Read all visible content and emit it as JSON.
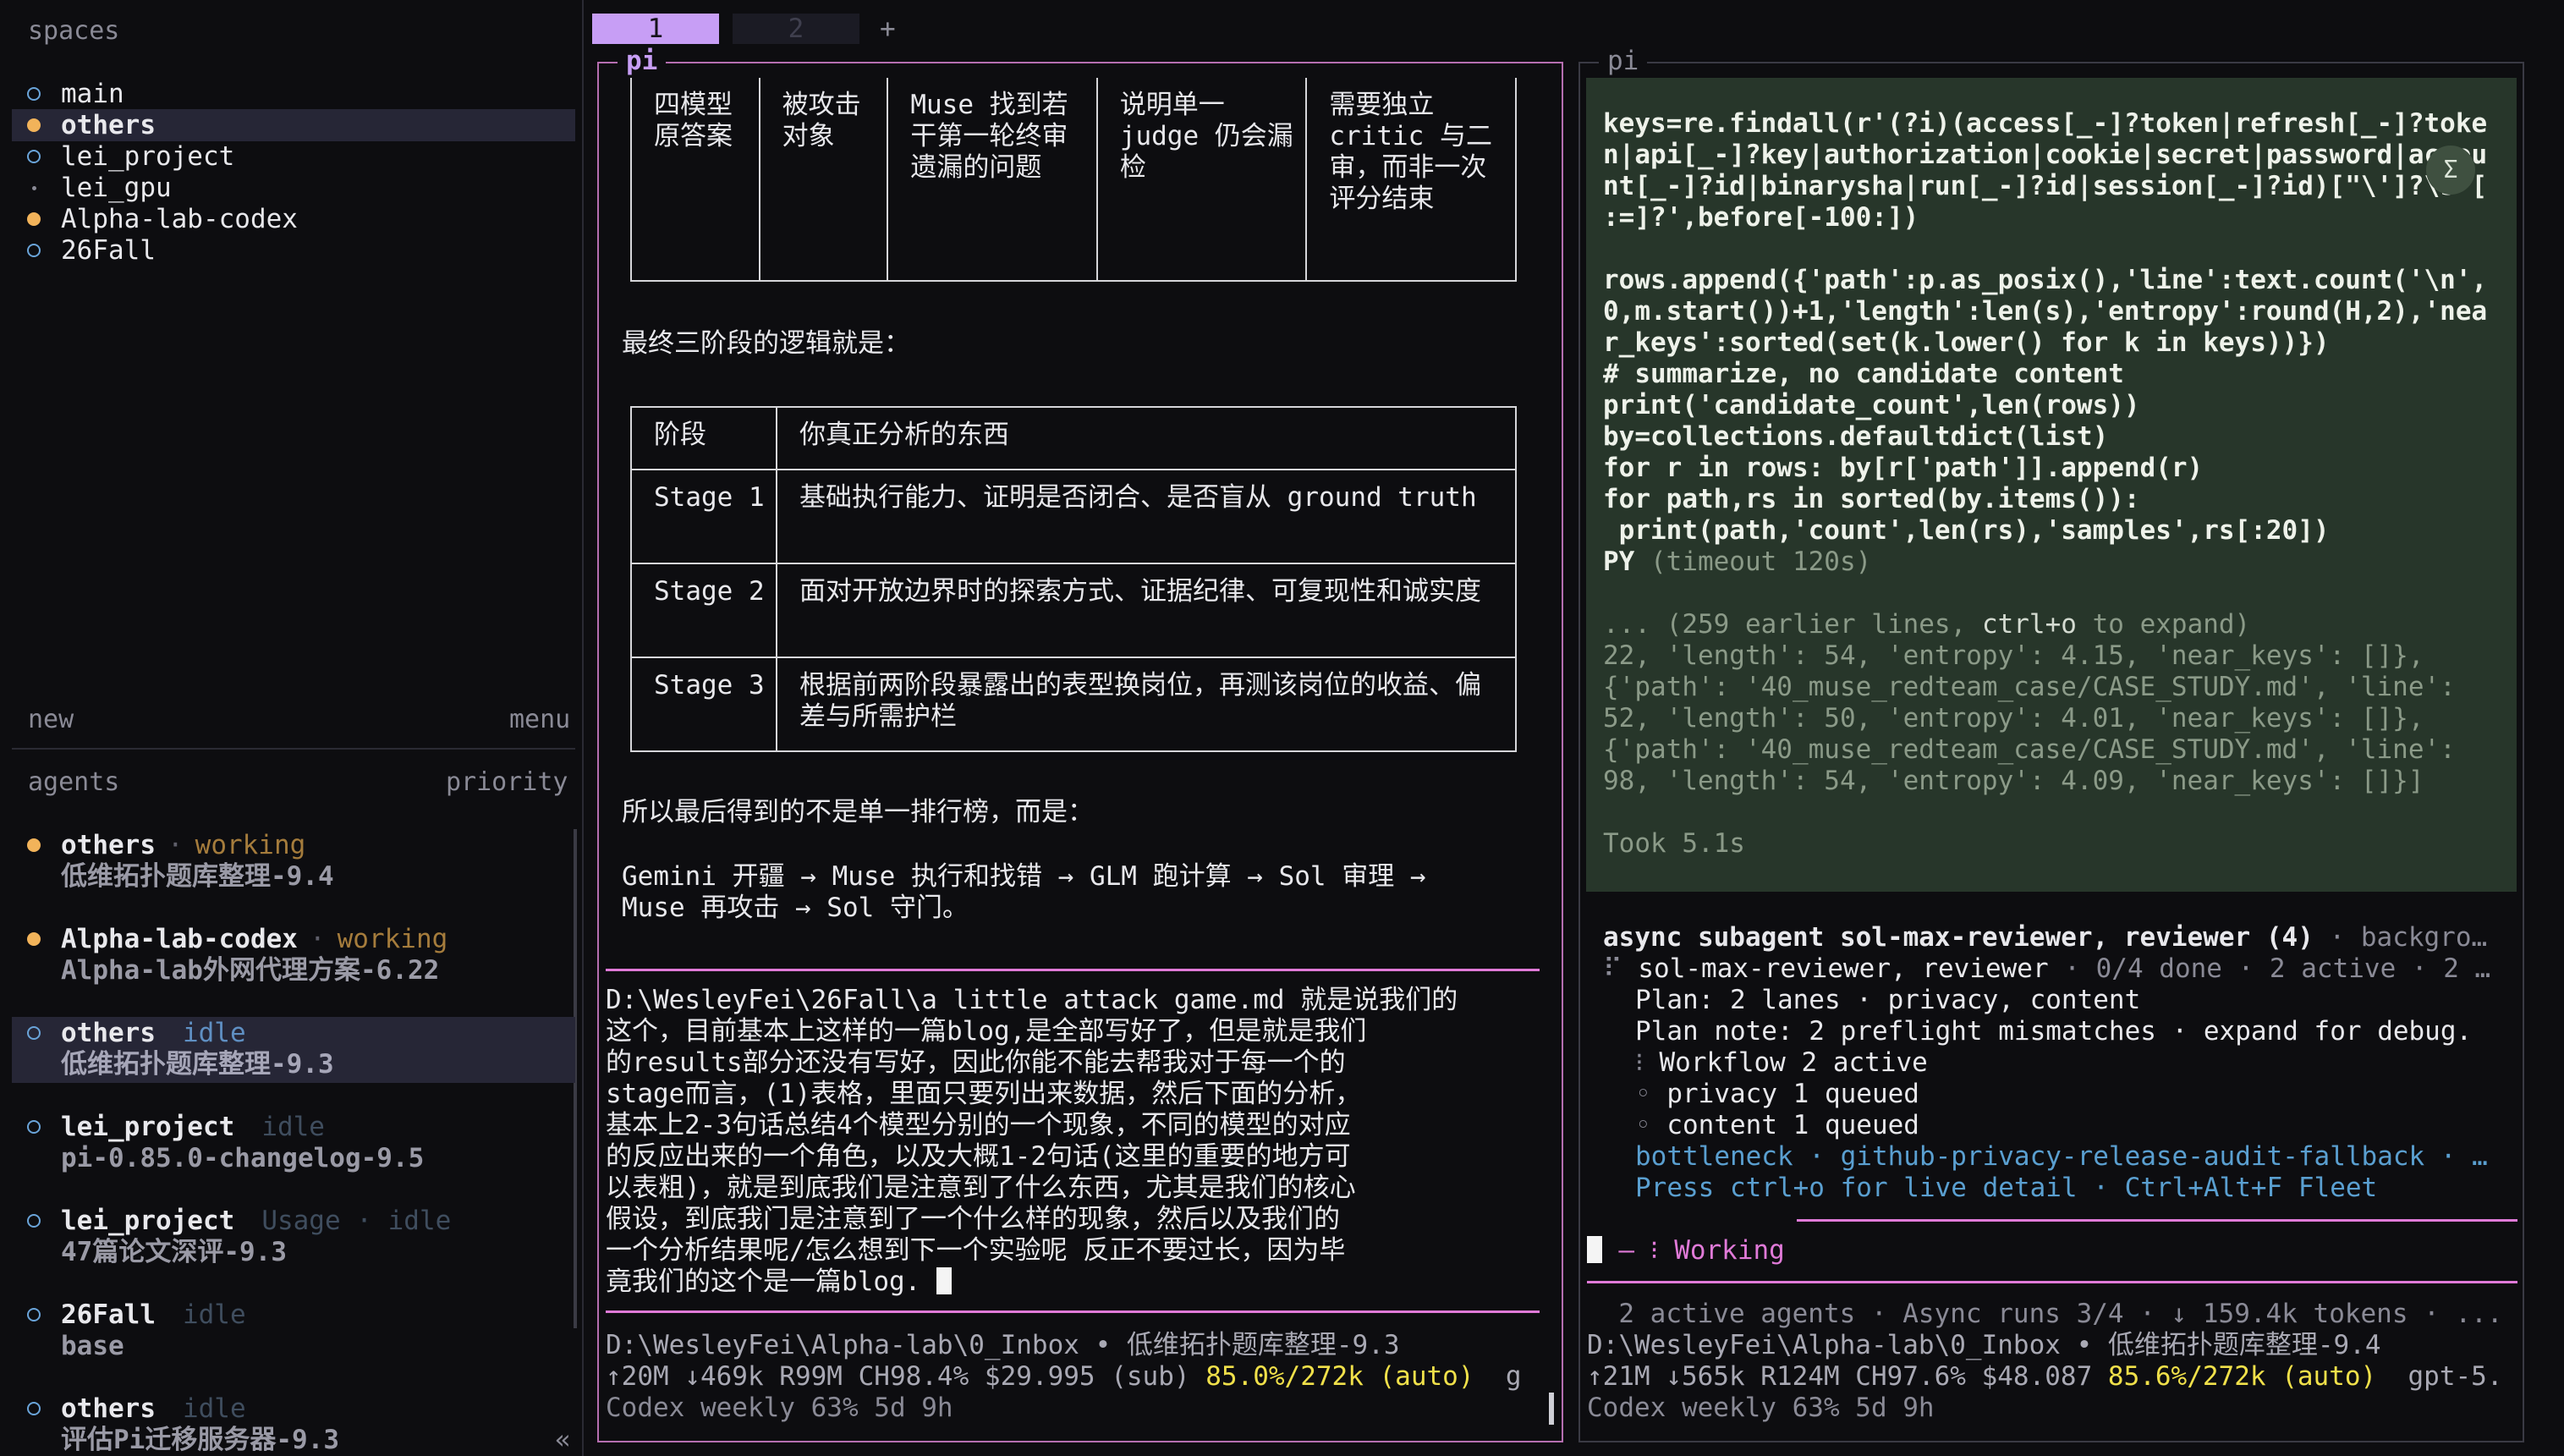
{
  "sidebar": {
    "spaces_header": "spaces",
    "spaces": [
      {
        "name": "main",
        "marker": "hollow",
        "selected": false
      },
      {
        "name": "others",
        "marker": "filled",
        "selected": true
      },
      {
        "name": "lei_project",
        "marker": "hollow",
        "selected": false
      },
      {
        "name": "lei_gpu",
        "marker": "tiny",
        "selected": false
      },
      {
        "name": "Alpha-lab-codex",
        "marker": "filled",
        "selected": false
      },
      {
        "name": "26Fall",
        "marker": "hollow",
        "selected": false
      }
    ],
    "new_label": "new",
    "menu_label": "menu",
    "agents_header": "agents",
    "priority_label": "priority",
    "agents": [
      {
        "name": "others",
        "sep": "·",
        "status": "working",
        "task": "低维拓扑题库整理-9.4",
        "marker": "filled",
        "selected": false
      },
      {
        "name": "Alpha-lab-codex",
        "sep": "·",
        "status": "working",
        "task": "Alpha-lab外网代理方案-6.22",
        "marker": "filled",
        "selected": false
      },
      {
        "name": "others",
        "sep": "",
        "status": "idle",
        "task": "低维拓扑题库整理-9.3",
        "marker": "hollow",
        "selected": true
      },
      {
        "name": "lei_project",
        "sep": "",
        "status": "idle",
        "task": "pi-0.85.0-changelog-9.5",
        "marker": "hollow",
        "selected": false
      },
      {
        "name": "lei_project",
        "sep": "",
        "status": "Usage · idle",
        "task": "47篇论文深评-9.3",
        "marker": "hollow",
        "selected": false
      },
      {
        "name": "26Fall",
        "sep": "",
        "status": "idle",
        "task": "base",
        "marker": "hollow",
        "selected": false
      },
      {
        "name": "others",
        "sep": "",
        "status": "idle",
        "task": "评估Pi迁移服务器-9.3",
        "marker": "hollow",
        "selected": false
      }
    ],
    "collapse_glyph": "«"
  },
  "tabs": {
    "items": [
      "1",
      "2"
    ],
    "active": 0,
    "add": "+"
  },
  "left_pane": {
    "title": "pi",
    "table1": [
      [
        "四模型原答案",
        "被攻击对象",
        "Muse 找到若干第一轮终审遗漏的问题",
        "说明单一 judge 仍会漏检",
        "需要独立 critic 与二审，而非一次评分结束"
      ]
    ],
    "para1": "最终三阶段的逻辑就是：",
    "table2": {
      "header": [
        "阶段",
        "你真正分析的东西"
      ],
      "rows": [
        [
          "Stage 1",
          "基础执行能力、证明是否闭合、是否盲从 ground truth"
        ],
        [
          "Stage 2",
          "面对开放边界时的探索方式、证据纪律、可复现性和诚实度"
        ],
        [
          "Stage 3",
          "根据前两阶段暴露出的表型换岗位，再测该岗位的收益、偏差与所需护栏"
        ]
      ]
    },
    "para2": "所以最后得到的不是单一排行榜，而是：",
    "flow_line1": "Gemini 开疆 → Muse 执行和找错 → GLM 跑计算 → Sol 审理 →",
    "flow_line2": "Muse 再攻击 → Sol 守门。",
    "input_lines": [
      "D:\\WesleyFei\\26Fall\\a little attack game.md 就是说我们的",
      "这个，目前基本上这样的一篇blog,是全部写好了，但是就是我们",
      "的results部分还没有写好，因此你能不能去帮我对于每一个的",
      "stage而言，(1)表格，里面只要列出来数据，然后下面的分析，",
      "基本上2-3句话总结4个模型分别的一个现象，不同的模型的对应",
      "的反应出来的一个角色，以及大概1-2句话(这里的重要的地方可",
      "以表粗)，就是到底我们是注意到了什么东西，尤其是我们的核心",
      "假设，到底我门是注意到了一个什么样的现象，然后以及我们的",
      "一个分析结果呢/怎么想到下一个实验呢 反正不要过长，因为毕",
      "竟我们的这个是一篇blog. "
    ],
    "status_path": "D:\\WesleyFei\\Alpha-lab\\0_Inbox • 低维拓扑题库整理-9.3",
    "status_stats": "↑20M ↓469k R99M CH98.4% $29.995 (sub) ",
    "status_ctx": "85.0%/272k (auto)",
    "status_tail": "  g",
    "status_usage": "Codex weekly 63% 5d 9h"
  },
  "right_pane": {
    "title": "pi",
    "code_lines": [
      "keys=re.findall(r'(?i)(access[_-]?token|refresh[_-]?toke",
      "n|api[_-]?key|authorization|cookie|secret|password|accou",
      "nt[_-]?id|binarysha|run[_-]?id|session[_-]?id)[\"\\']?\\s*[",
      ":=]?',before[-100:])",
      "",
      "rows.append({'path':p.as_posix(),'line':text.count('\\n',",
      "0,m.start())+1,'length':len(s),'entropy':round(H,2),'nea",
      "r_keys':sorted(set(k.lower() for k in keys))})",
      "# summarize, no candidate content",
      "print('candidate_count',len(rows))",
      "by=collections.defaultdict(list)",
      "for r in rows: by[r['path']].append(r)",
      "for path,rs in sorted(by.items()):",
      " print(path,'count',len(rs),'samples',rs[:20])"
    ],
    "code_end": "PY",
    "timeout": " (timeout 120s)",
    "expand_note_a": "... (259 earlier lines, ",
    "expand_key": "ctrl+o",
    "expand_note_b": " to expand)",
    "output_lines": [
      "22, 'length': 54, 'entropy': 4.15, 'near_keys': []},",
      "{'path': '40_muse_redteam_case/CASE_STUDY.md', 'line':",
      "52, 'length': 50, 'entropy': 4.01, 'near_keys': []},",
      "{'path': '40_muse_redteam_case/CASE_STUDY.md', 'line':",
      "98, 'length': 54, 'entropy': 4.09, 'near_keys': []}]"
    ],
    "took": "Took 5.1s",
    "badge": "Σ",
    "subagent_title": "async subagent sol-max-reviewer, reviewer (4)",
    "subagent_title_tail": " · backgro…",
    "sub_lines": [
      {
        "glyph": "⠏",
        "text": " sol-max-reviewer, reviewer",
        "dim": " · 0/4 done · 2 active · 2 …"
      },
      {
        "glyph": "",
        "text": "Plan: 2 lanes · privacy, content",
        "dim": ""
      },
      {
        "glyph": "",
        "text": "Plan note: 2 preflight mismatches · expand for debug.",
        "dim": ""
      },
      {
        "glyph": "⁝",
        "text": " Workflow 2 active",
        "dim": ""
      },
      {
        "glyph": "◦",
        "text": " privacy 1 queued",
        "dim": ""
      },
      {
        "glyph": "◦",
        "text": " content 1 queued",
        "dim": ""
      }
    ],
    "bottleneck": "bottleneck · github-privacy-release-audit-fallback · …",
    "press_hint": "Press ctrl+o for live detail · Ctrl+Alt+F Fleet",
    "working_prefix": "— ⁝ ",
    "working_label": "Working",
    "status_agents": "  2 active agents · Async runs 3/4 · ↓ 159.4k tokens · ...",
    "status_path": "D:\\WesleyFei\\Alpha-lab\\0_Inbox • 低维拓扑题库整理-9.4",
    "status_stats": "↑21M ↓565k R124M CH97.6% $48.087 ",
    "status_ctx": "85.6%/272k (auto)",
    "status_tail": "  gpt-5.",
    "status_usage": "Codex weekly 63% 5d 9h"
  },
  "colors": {
    "accent_pink": "#e07ad8",
    "tab_active": "#c79ef5",
    "working_orange": "#f2b35a",
    "idle_blue": "#6aa4d9",
    "code_bg": "#27362a",
    "context_yellow": "#f0e04a"
  }
}
